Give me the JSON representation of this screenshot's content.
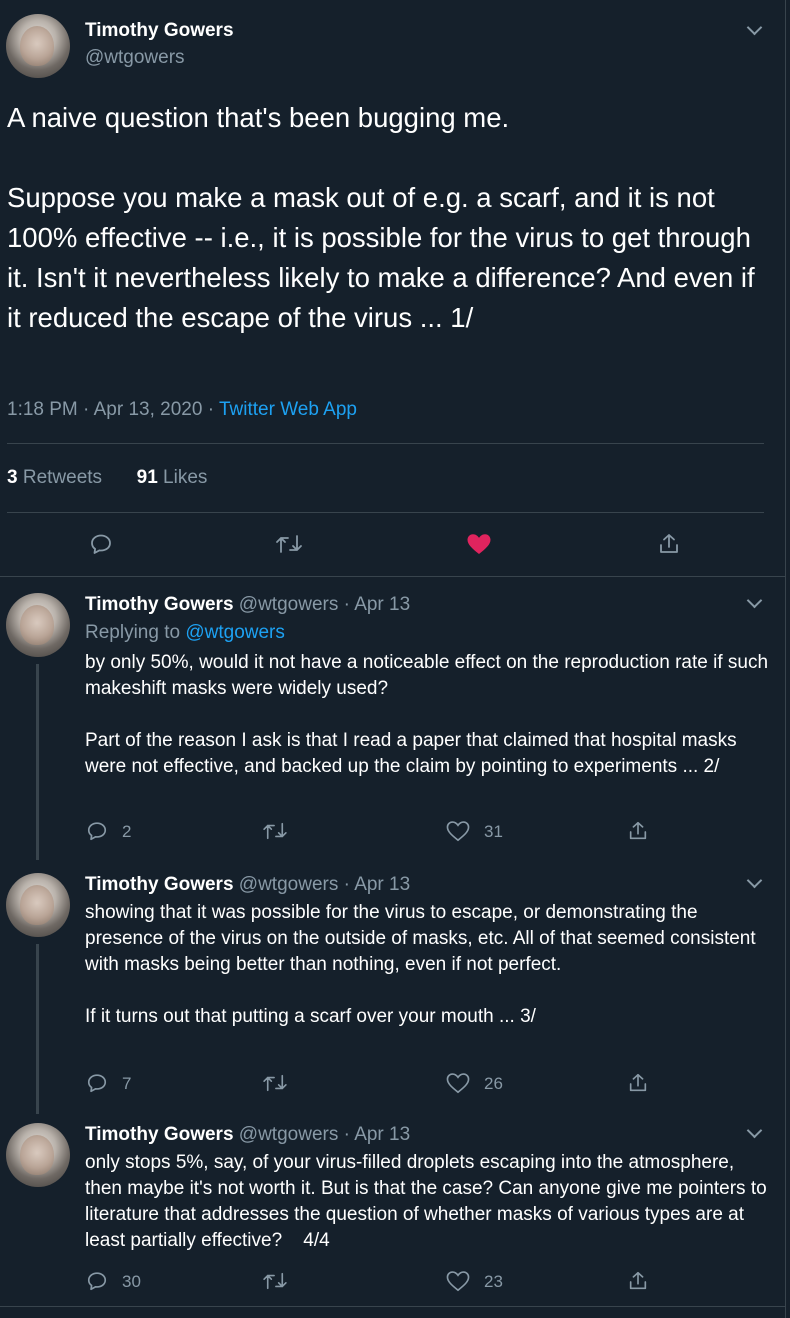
{
  "main_tweet": {
    "author_name": "Timothy Gowers",
    "author_handle": "@wtgowers",
    "text_p1": "A naive question that's been bugging me.",
    "text_p2": "Suppose you make a mask out of e.g. a scarf, and it is not 100% effective -- i.e., it is possible for the virus to get through it. Isn't it nevertheless likely to make a difference? And even if it reduced the escape of the virus ... 1/",
    "time": "1:18 PM",
    "date": "Apr 13, 2020",
    "source": "Twitter Web App",
    "retweets_count": "3",
    "retweets_label": "Retweets",
    "likes_count": "91",
    "likes_label": "Likes",
    "liked_color": "#e0245e"
  },
  "replies": [
    {
      "name": "Timothy Gowers",
      "handle": "@wtgowers",
      "date": "Apr 13",
      "replying_label": "Replying to",
      "replying_to": "@wtgowers",
      "p1": "by only 50%, would it not have a noticeable effect on the reproduction rate if such makeshift masks were widely used?",
      "p2": "Part of the reason I ask is that I read a paper that claimed that hospital masks were not effective, and backed up the claim by pointing to experiments ... 2/",
      "reply_count": "2",
      "like_count": "31"
    },
    {
      "name": "Timothy Gowers",
      "handle": "@wtgowers",
      "date": "Apr 13",
      "p1": "showing that it was possible for the virus to escape, or demonstrating the presence of the virus on the outside of masks, etc. All of that seemed consistent with masks being better than nothing, even if not perfect.",
      "p2": "If it turns out that putting a scarf over your mouth ... 3/",
      "reply_count": "7",
      "like_count": "26"
    },
    {
      "name": "Timothy Gowers",
      "handle": "@wtgowers",
      "date": "Apr 13",
      "p1": "only stops 5%, say, of your virus-filled droplets escaping into the atmosphere, then maybe it's not worth it. But is that the case? Can anyone give me pointers to literature that addresses the question of whether masks of various types are at least partially effective?    4/4",
      "reply_count": "30",
      "like_count": "23"
    }
  ],
  "icons": [
    "reply-icon",
    "retweet-icon",
    "like-icon",
    "share-icon",
    "chevron-down-icon"
  ],
  "colors": {
    "background": "#15202b",
    "secondary_text": "#8899a6",
    "link": "#1da1f2",
    "divider": "#38444d"
  }
}
